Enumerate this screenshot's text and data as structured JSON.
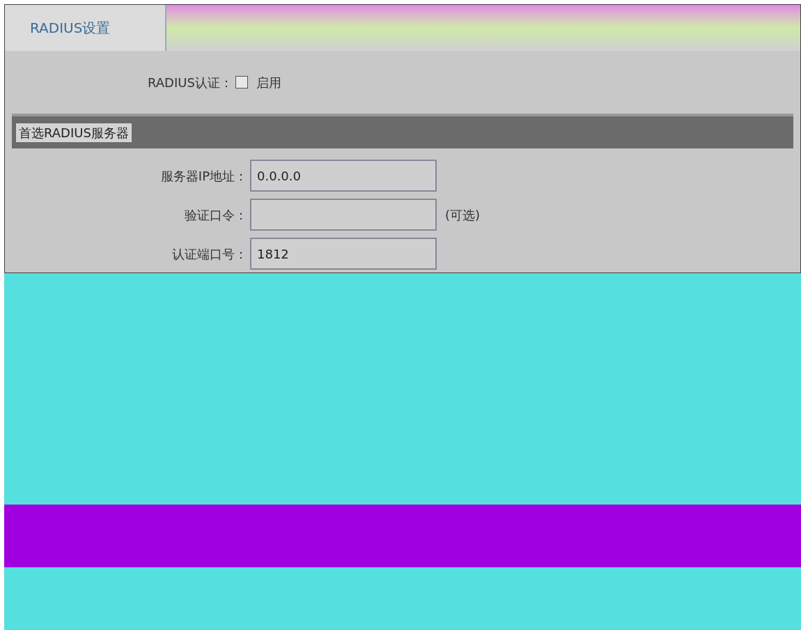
{
  "tab": {
    "label": "RADIUS设置",
    "selected": true
  },
  "auth": {
    "label": "RADIUS认证：",
    "option": "启用",
    "checked": false
  },
  "section": {
    "title": "首选RADIUS服务器"
  },
  "fields": [
    {
      "label": "服务器IP地址：",
      "value": "0.0.0.0"
    },
    {
      "label": "验证口令：",
      "note": "(可选)"
    },
    {
      "label": "认证端口号：",
      "value": "1812"
    }
  ]
}
